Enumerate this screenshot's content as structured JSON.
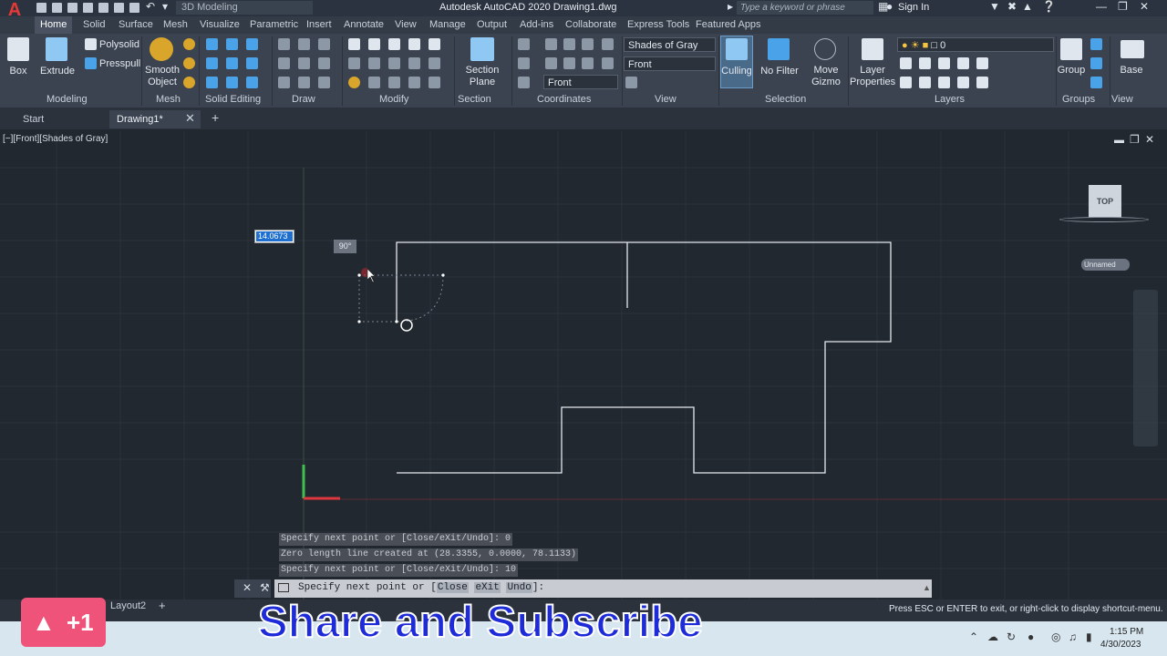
{
  "app": {
    "logo": "A",
    "workspace": "3D Modeling",
    "title": "Autodesk AutoCAD 2020    Drawing1.dwg",
    "search_placeholder": "Type a keyword or phrase",
    "sign_in": "Sign In"
  },
  "ribbon": {
    "tabs": [
      "Home",
      "Solid",
      "Surface",
      "Mesh",
      "Visualize",
      "Parametric",
      "Insert",
      "Annotate",
      "View",
      "Manage",
      "Output",
      "Add-ins",
      "Collaborate",
      "Express Tools",
      "Featured Apps"
    ],
    "active_tab": "Home",
    "buttons": {
      "box": "Box",
      "extrude": "Extrude",
      "polysolid": "Polysolid",
      "presspull": "Presspull",
      "smooth_object_1": "Smooth",
      "smooth_object_2": "Object",
      "section_plane_1": "Section",
      "section_plane_2": "Plane",
      "culling": "Culling",
      "no_filter": "No Filter",
      "move_gizmo_1": "Move",
      "move_gizmo_2": "Gizmo",
      "layer_properties_1": "Layer",
      "layer_properties_2": "Properties",
      "group": "Group",
      "base": "Base"
    },
    "dropdowns": {
      "visual_style": "Shades of Gray",
      "view": "Front",
      "ucs": "Front",
      "layer": "0"
    },
    "panels": {
      "modeling": "Modeling",
      "mesh": "Mesh",
      "solid_editing": "Solid Editing",
      "draw": "Draw",
      "modify": "Modify",
      "section": "Section",
      "coordinates": "Coordinates",
      "view": "View",
      "selection": "Selection",
      "layers": "Layers",
      "groups": "Groups",
      "view2": "View"
    }
  },
  "doc_tabs": {
    "start": "Start",
    "drawing": "Drawing1*"
  },
  "viewport": {
    "label": "[−][Front][Shades of Gray]",
    "dynamic_input_value": "14.0673",
    "angle_tooltip": "90°",
    "viewcube_face": "TOP",
    "ucs_name": "Unnamed"
  },
  "command": {
    "history": [
      "Specify next point or [Close/eXit/Undo]: 0",
      "Zero length line created at (28.3355, 0.0000, 78.1133)",
      "Specify next point or [Close/eXit/Undo]: 10"
    ],
    "prompt_prefix": "Specify next point or [",
    "options": [
      "Close",
      "eXit",
      "Undo"
    ],
    "prompt_suffix": "]:"
  },
  "status": {
    "layout": "Layout2",
    "hint": "Press ESC or ENTER to exit, or right-click to display shortcut-menu."
  },
  "overlay": {
    "subscribe_text": "Share and Subscribe",
    "like_badge": "+1"
  },
  "taskbar": {
    "time": "1:15 PM",
    "date": "4/30/2023"
  },
  "colors": {
    "accent": "#4aa3e8",
    "background": "#212830",
    "ribbon": "#3b4350",
    "overlay_text": "#1e2bd8",
    "like_badge": "#f0537a"
  }
}
